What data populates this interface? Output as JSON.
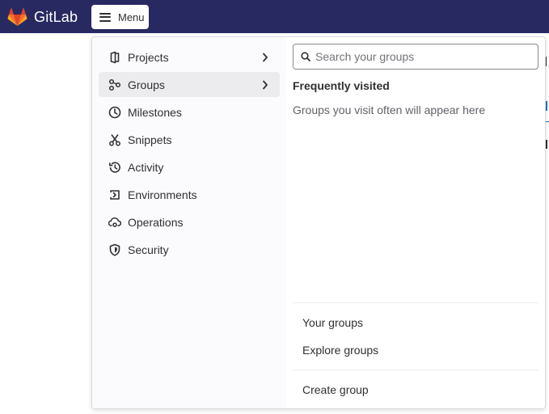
{
  "navbar": {
    "brand_name": "GitLab",
    "brand_icon": "gitlab-tanuki-icon",
    "menu_label": "Menu",
    "menu_icon": "hamburger-icon",
    "colors": {
      "navbar_bg": "#292961",
      "logo_orange": "#fc6d26",
      "logo_red": "#e24329",
      "logo_light": "#fca326"
    }
  },
  "menu": {
    "items": [
      {
        "label": "Projects",
        "icon": "project-icon",
        "has_submenu": true,
        "active": false
      },
      {
        "label": "Groups",
        "icon": "group-icon",
        "has_submenu": true,
        "active": true
      },
      {
        "label": "Milestones",
        "icon": "clock-icon",
        "has_submenu": false,
        "active": false
      },
      {
        "label": "Snippets",
        "icon": "snippet-icon",
        "has_submenu": false,
        "active": false
      },
      {
        "label": "Activity",
        "icon": "history-icon",
        "has_submenu": false,
        "active": false
      },
      {
        "label": "Environments",
        "icon": "environment-icon",
        "has_submenu": false,
        "active": false
      },
      {
        "label": "Operations",
        "icon": "cloud-gear-icon",
        "has_submenu": false,
        "active": false
      },
      {
        "label": "Security",
        "icon": "shield-icon",
        "has_submenu": false,
        "active": false
      }
    ]
  },
  "groups_panel": {
    "search_placeholder": "Search your groups",
    "search_value": "",
    "frequently_visited_title": "Frequently visited",
    "frequently_visited_empty": "Groups you visit often will appear here",
    "links": {
      "your_groups": "Your groups",
      "explore_groups": "Explore groups",
      "create_group": "Create group"
    }
  }
}
